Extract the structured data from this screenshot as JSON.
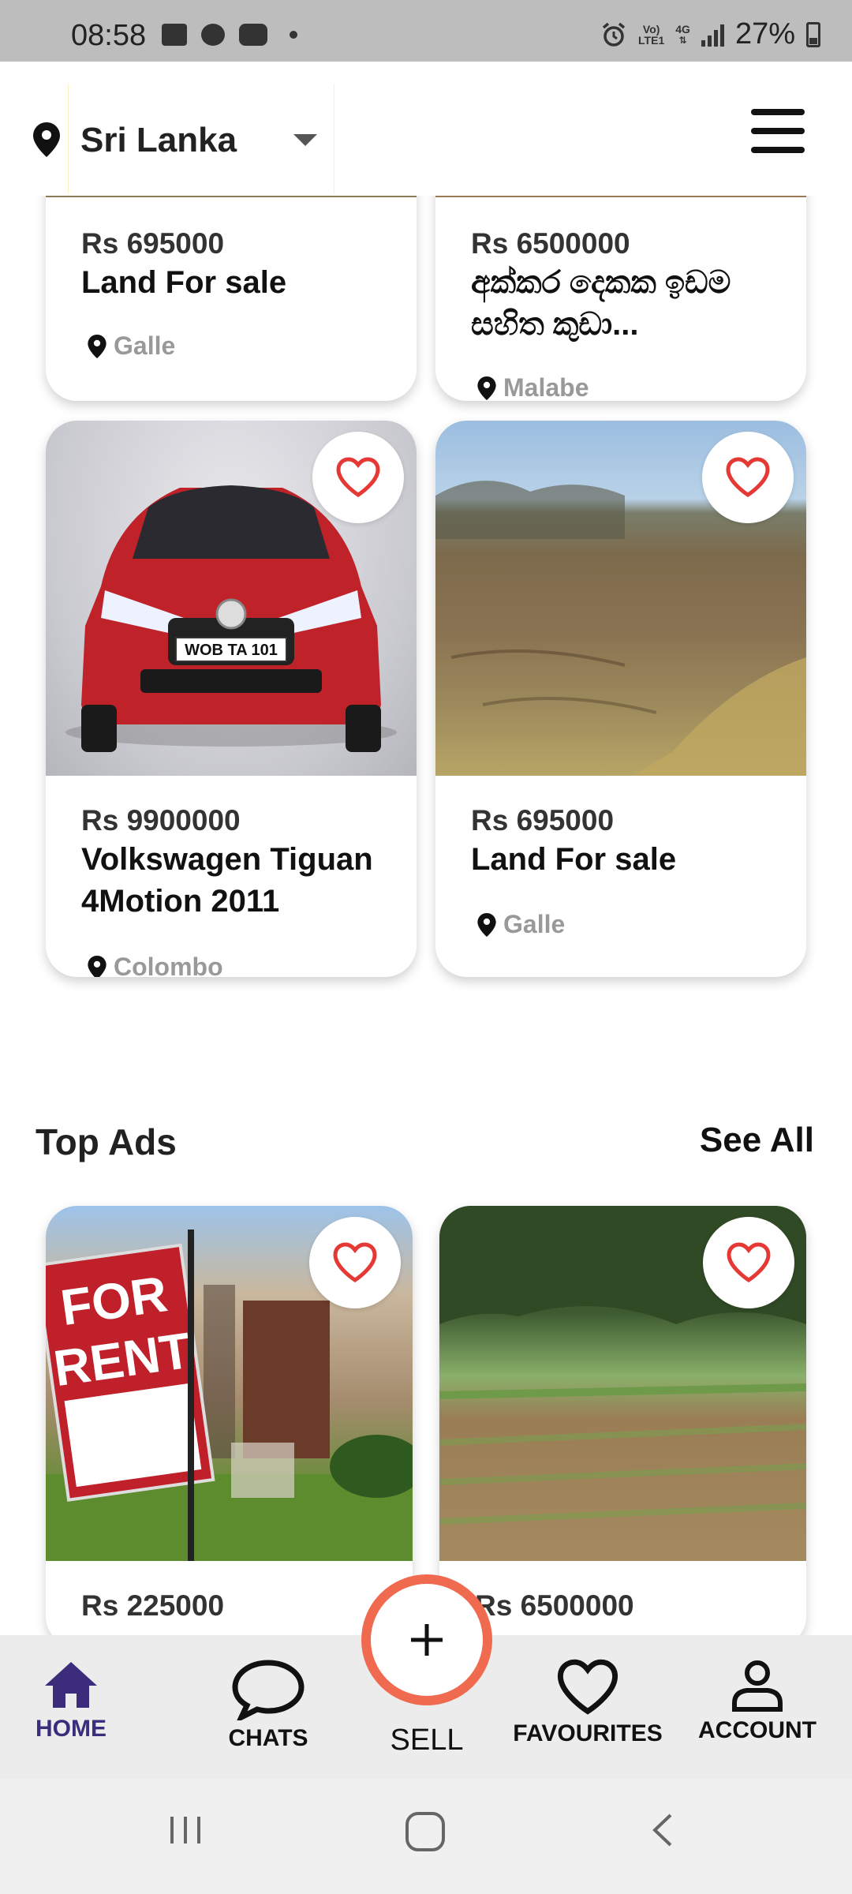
{
  "status_bar": {
    "time": "08:58",
    "network_top": "Vo)",
    "network_mid": "LTE1",
    "network_type": "4G",
    "battery": "27%"
  },
  "header": {
    "location": "Sri Lanka"
  },
  "ads_grid": [
    {
      "price": "Rs 695000",
      "title": "Land For sale",
      "location": "Galle",
      "image": "land-photo"
    },
    {
      "price": "Rs 6500000",
      "title": "අක්කර දෙකක ඉඩම සහිත කුඩා...",
      "location": "Malabe",
      "image": "land-photo"
    },
    {
      "price": "Rs 9900000",
      "title": "Volkswagen Tiguan 4Motion 2011",
      "location": "Colombo",
      "image": "red-car-photo"
    },
    {
      "price": "Rs 695000",
      "title": "Land For sale",
      "location": "Galle",
      "image": "field-photo"
    }
  ],
  "top_ads": {
    "title": "Top Ads",
    "see_all": "See All",
    "items": [
      {
        "price": "Rs 225000",
        "image": "for-rent-sign-photo",
        "sign_line1": "FOR",
        "sign_line2": "RENT"
      },
      {
        "price": "Rs 6500000",
        "image": "farmland-photo"
      }
    ]
  },
  "bottom_nav": {
    "home": "HOME",
    "chats": "CHATS",
    "sell": "SELL",
    "favourites": "FAVOURITES",
    "account": "ACCOUNT"
  },
  "colors": {
    "accent": "#3b2d7c",
    "fab_ring": "#f06a4f",
    "heart": "#e53935"
  }
}
